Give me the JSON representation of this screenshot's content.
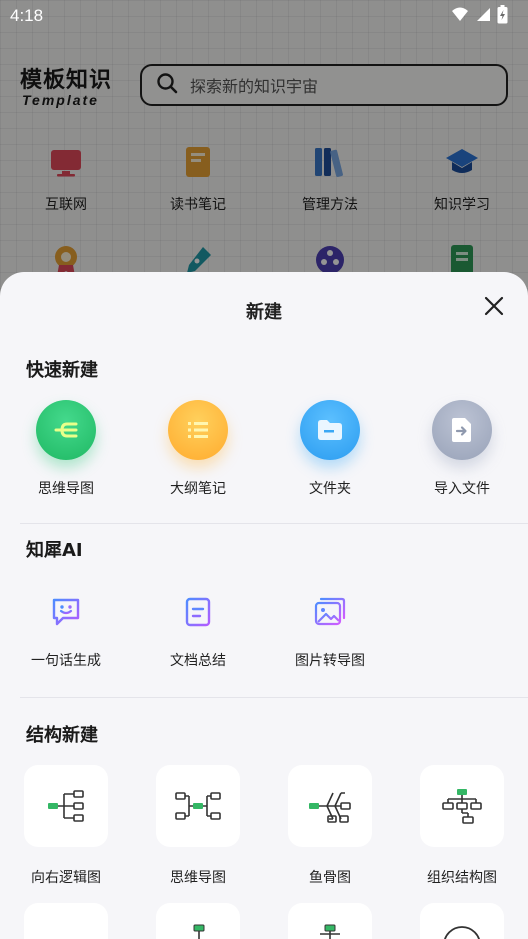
{
  "status_bar": {
    "time": "4:18"
  },
  "app": {
    "logo_cn": "模板知识",
    "logo_en": "Template",
    "search_placeholder": "探索新的知识宇宙",
    "categories": [
      {
        "label": "互联网",
        "icon": "monitor-icon",
        "color": "#e2495b"
      },
      {
        "label": "读书笔记",
        "icon": "book-icon",
        "color": "#e8a235"
      },
      {
        "label": "管理方法",
        "icon": "books-icon",
        "color": "#3a78c9"
      },
      {
        "label": "知识学习",
        "icon": "graduation-cap-icon",
        "color": "#2b74d6"
      },
      {
        "label": "",
        "icon": "award-icon",
        "color": "#e8a235"
      },
      {
        "label": "",
        "icon": "pen-icon",
        "color": "#1f9aa8"
      },
      {
        "label": "",
        "icon": "film-reel-icon",
        "color": "#4c3fb3"
      },
      {
        "label": "",
        "icon": "document-icon",
        "color": "#2e9a56"
      }
    ]
  },
  "sheet": {
    "title": "新建",
    "quick": {
      "title": "快速新建",
      "items": [
        {
          "label": "思维导图",
          "icon": "mindmap-icon",
          "color": "#2fc97a"
        },
        {
          "label": "大纲笔记",
          "icon": "list-icon",
          "color": "#ffb43a"
        },
        {
          "label": "文件夹",
          "icon": "folder-icon",
          "color": "#3aa8f5"
        },
        {
          "label": "导入文件",
          "icon": "import-file-icon",
          "color": "#a7b0c4"
        }
      ]
    },
    "ai": {
      "title": "知犀AI",
      "items": [
        {
          "label": "一句话生成",
          "icon": "chat-smile-icon"
        },
        {
          "label": "文档总结",
          "icon": "doc-summary-icon"
        },
        {
          "label": "图片转导图",
          "icon": "image-convert-icon"
        }
      ]
    },
    "structure": {
      "title": "结构新建",
      "items": [
        {
          "label": "向右逻辑图",
          "icon": "right-logic-icon"
        },
        {
          "label": "思维导图",
          "icon": "mindmap-structure-icon"
        },
        {
          "label": "鱼骨图",
          "icon": "fishbone-icon"
        },
        {
          "label": "组织结构图",
          "icon": "org-chart-icon"
        },
        {
          "label": "",
          "icon": "structure-icon"
        },
        {
          "label": "",
          "icon": "tree-down-icon"
        },
        {
          "label": "",
          "icon": "tree-icon"
        },
        {
          "label": "",
          "icon": "circle-icon"
        }
      ]
    }
  },
  "colors": {
    "accent_green": "#34b765",
    "node_stroke": "#333333"
  }
}
